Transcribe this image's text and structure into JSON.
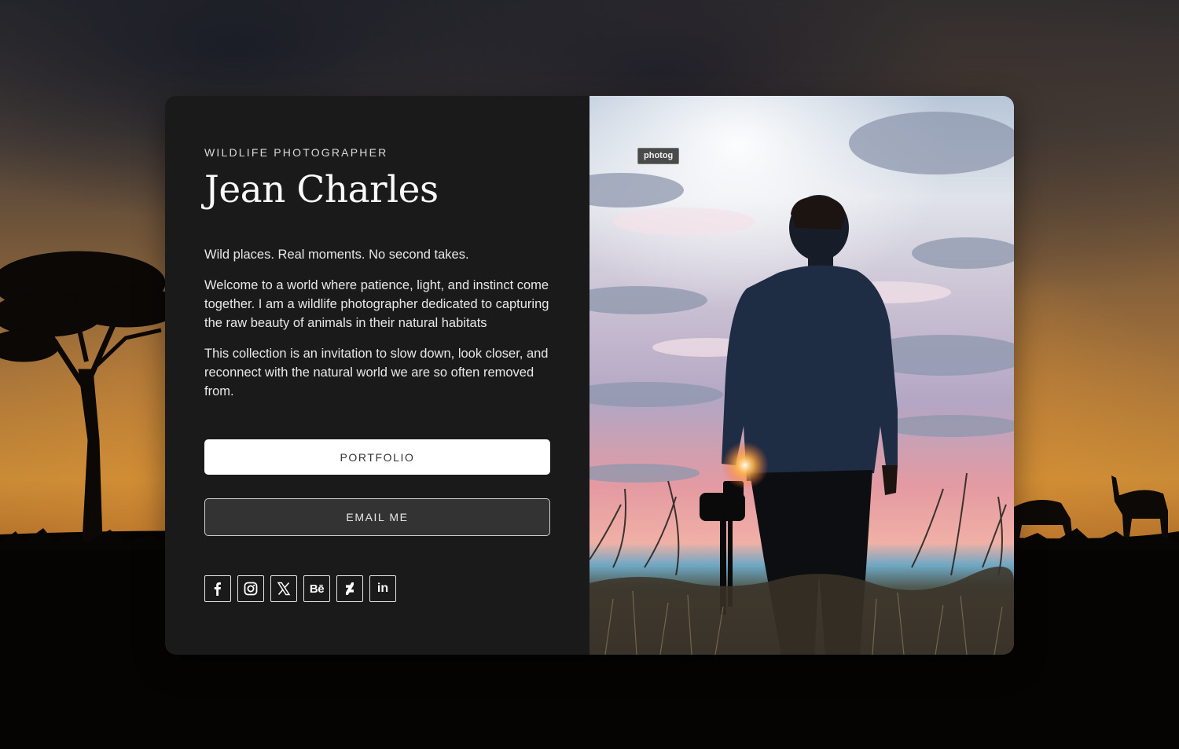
{
  "profile": {
    "eyebrow": "WILDLIFE PHOTOGRAPHER",
    "name": "Jean Charles",
    "tagline": "Wild places. Real moments. No second takes.",
    "paragraphs": [
      "Welcome to a world where patience, light, and instinct come together. I am a wildlife photographer dedicated to capturing the raw beauty of animals in their natural habitats",
      "This collection is an invitation to slow down, look closer, and reconnect with the natural world we are so often removed from."
    ]
  },
  "buttons": {
    "portfolio": "PORTFOLIO",
    "email": "EMAIL ME"
  },
  "socials": [
    {
      "icon": "facebook-icon"
    },
    {
      "icon": "instagram-icon"
    },
    {
      "icon": "x-icon"
    },
    {
      "icon": "behance-icon",
      "text": "Bē"
    },
    {
      "icon": "deviantart-icon"
    },
    {
      "icon": "linkedin-icon",
      "text": "in"
    }
  ],
  "photo": {
    "tag": "photog"
  },
  "colors": {
    "card_bg": "#1a1a1b",
    "button_primary_bg": "#ffffff",
    "button_secondary_bg": "#333334"
  }
}
